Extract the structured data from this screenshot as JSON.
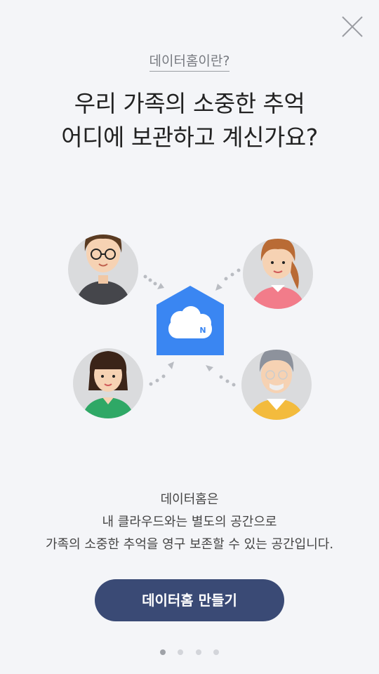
{
  "header": {
    "close_icon": "close-icon",
    "subtitle": "데이터홈이란?",
    "headline_line1": "우리 가족의 소중한 추억",
    "headline_line2": "어디에 보관하고 계신가요?"
  },
  "illustration": {
    "center_icon": "cloud-home-icon",
    "center_badge": "N",
    "colors": {
      "home": "#3a86f2",
      "cloud": "#ffffff"
    }
  },
  "description": {
    "line1": "데이터홈은",
    "line2": "내 클라우드와는 별도의 공간으로",
    "line3": "가족의 소중한 추억을 영구 보존할 수 있는 공간입니다."
  },
  "cta": {
    "label": "데이터홈 만들기",
    "color": "#3a4a75"
  },
  "pager": {
    "total": 4,
    "current": 1
  }
}
